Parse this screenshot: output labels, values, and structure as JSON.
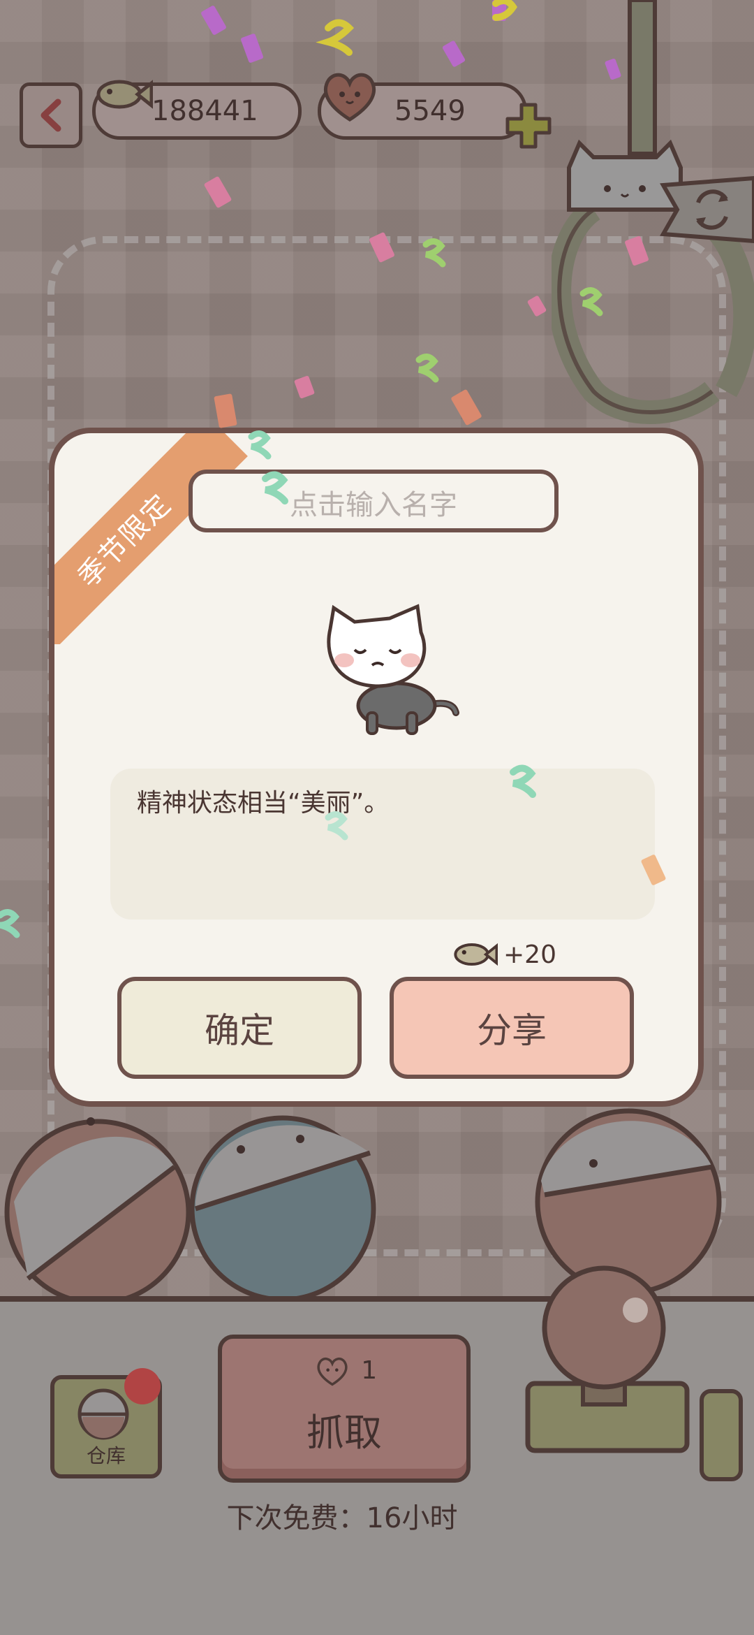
{
  "currency": {
    "fish_count": "188441",
    "heart_count": "5549"
  },
  "dialog": {
    "ribbon": "季节限定",
    "name_placeholder": "点击输入名字",
    "description": "精神状态相当“美丽”。",
    "reward": "+20",
    "confirm_label": "确定",
    "share_label": "分享"
  },
  "bottom": {
    "warehouse_label": "仓库",
    "grab_cost": "1",
    "grab_label": "抓取",
    "next_free": "下次免费：16小时"
  },
  "colors": {
    "outline": "#4a3632",
    "ribbon": "#e49e6f",
    "share": "#f5c6b6",
    "confirm": "#efebd9"
  }
}
